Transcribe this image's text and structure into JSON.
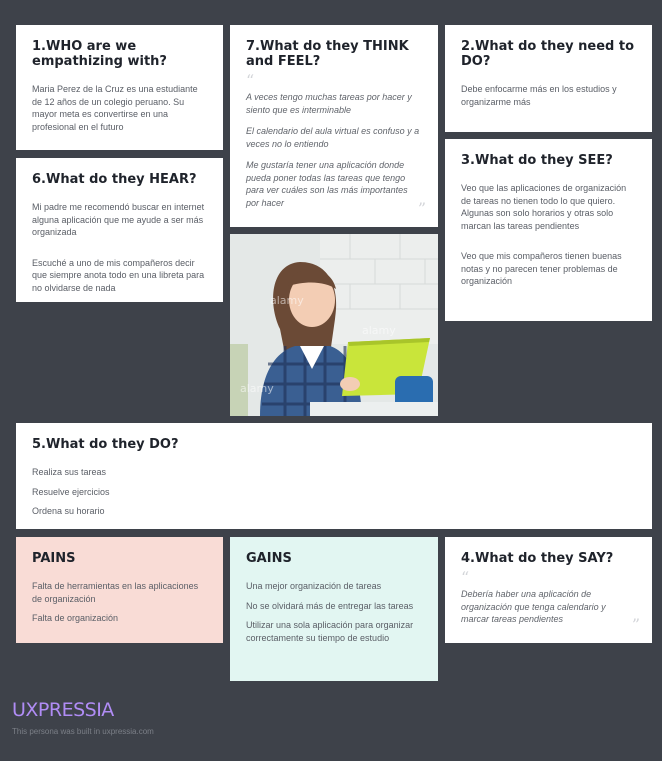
{
  "who": {
    "title": "1.WHO are we empathizing with?",
    "text": "Maria Perez de la Cruz es una estudiante de 12 años de un colegio peruano. Su mayor meta es convertirse en una profesional en el futuro"
  },
  "think_feel": {
    "title": "7.What do they THINK and FEEL?",
    "quotes": [
      "A veces tengo muchas tareas por hacer y siento que es interminable",
      "El calendario del aula virtual es confuso y a veces no lo entiendo",
      "Me gustaría tener una aplicación donde pueda poner todas las tareas que tengo para ver cuáles son las más importantes por hacer"
    ]
  },
  "need": {
    "title": "2.What do they need to DO?",
    "text": "Debe enfocarme más en los estudios y organizarme más"
  },
  "hear": {
    "title": "6.What do they HEAR?",
    "items": [
      "Mi padre me recomendó buscar en internet alguna aplicación que me ayude a ser más organizada",
      "Escuché a uno de mis compañeros decir que siempre anota todo en una libreta para no olvidarse de nada"
    ]
  },
  "see": {
    "title": "3.What do they SEE?",
    "items": [
      "Veo que las aplicaciones de organización de tareas no tienen todo lo que quiero. Algunas son solo horarios y otras solo marcan las tareas pendientes",
      "Veo que mis compañeros tienen buenas notas y no parecen tener problemas de organización"
    ]
  },
  "photo": {
    "watermark": "alamy"
  },
  "do": {
    "title": "5.What do they DO?",
    "items": [
      "Realiza sus tareas",
      "Resuelve ejercicios",
      "Ordena su horario"
    ]
  },
  "pains": {
    "title": "PAINS",
    "items": [
      "Falta de herramientas en las aplicaciones de organización",
      "Falta de organización"
    ]
  },
  "gains": {
    "title": "GAINS",
    "items": [
      "Una mejor organización de tareas",
      "No se olvidará más de entregar las tareas",
      "Utilizar una sola aplicación para organizar correctamente su tiempo de estudio"
    ]
  },
  "say": {
    "title": "4.What do they SAY?",
    "quote": "Debería haber una aplicación de organización que tenga calendario y marcar tareas pendientes"
  },
  "footer": {
    "brand": "UXPRESSIA",
    "credit": "This persona was built in uxpressia.com"
  },
  "colors": {
    "background": "#3e424a",
    "pains_bg": "#f9dcd6",
    "gains_bg": "#e2f6f2",
    "brand": "#b08cf5"
  }
}
